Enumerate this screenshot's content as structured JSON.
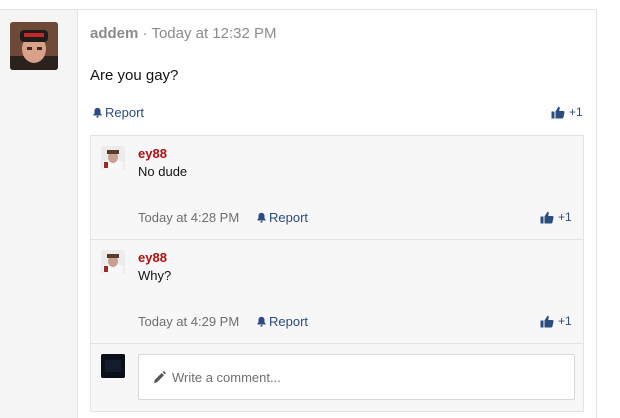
{
  "post": {
    "author": "addem",
    "separator": "·",
    "time": "Today at 12:32 PM",
    "body": "Are you gay?",
    "report_label": "Report",
    "like_count": "+1"
  },
  "comments": [
    {
      "author": "ey88",
      "text": "No dude",
      "time": "Today at 4:28 PM",
      "report_label": "Report",
      "like_count": "+1"
    },
    {
      "author": "ey88",
      "text": "Why?",
      "time": "Today at 4:29 PM",
      "report_label": "Report",
      "like_count": "+1"
    }
  ],
  "reply": {
    "placeholder": "Write a comment..."
  },
  "colors": {
    "link": "#2b4c7e",
    "comment_author": "#b01010",
    "meta": "#8c8c8c"
  }
}
